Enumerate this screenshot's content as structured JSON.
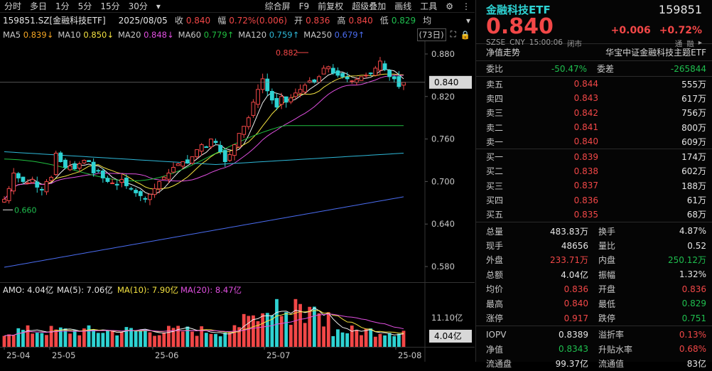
{
  "toolbar": {
    "left": [
      "分时",
      "多日",
      "1分",
      "5分",
      "15分",
      "30分",
      "▾"
    ],
    "right": [
      "综合屏",
      "F9",
      "前复权",
      "超级叠加",
      "画线",
      "工具"
    ]
  },
  "info": {
    "code": "159851.SZ[金融科技ETF]",
    "date": "2025/08/05",
    "close_label": "收",
    "close": "0.840",
    "change_label": "幅",
    "change": "0.72%(0.006)",
    "open_label": "开",
    "open": "0.836",
    "high_label": "高",
    "high": "0.840",
    "low_label": "低",
    "low": "0.829",
    "avg_label": "均"
  },
  "ma": [
    {
      "label": "MA5",
      "value": "0.839↓",
      "color": "#f0f0f0"
    },
    {
      "label": "MA10",
      "value": "0.850↓",
      "color": "#f5e341"
    },
    {
      "label": "MA20",
      "value": "0.848↓",
      "color": "#e04fe0"
    },
    {
      "label": "MA60",
      "value": "0.779↑",
      "color": "#20c040"
    },
    {
      "label": "MA120",
      "value": "0.759↑",
      "color": "#2eb8d8"
    },
    {
      "label": "MA250",
      "value": "0.679↑",
      "color": "#4a6cf0"
    }
  ],
  "ma_extra": "(73日)",
  "axis": {
    "price_ticks": [
      "0.880",
      "0.820",
      "0.760",
      "0.700",
      "0.640",
      "0.580"
    ],
    "current_tag": "0.840",
    "vol_tag": "4.04亿",
    "vol_tick": "11.10亿",
    "dates": [
      "25-04",
      "25-05",
      "25-06",
      "25-07",
      "25-08"
    ],
    "high_ann": "0.882",
    "low_ann": "0.660"
  },
  "volume": {
    "amo": "AMO: 4.04亿",
    "ma5": "MA(5): 7.06亿",
    "ma10": "MA(10): 7.90亿",
    "ma20": "MA(20): 8.47亿"
  },
  "colors": {
    "up": "#f24747",
    "down": "#1fbf4f",
    "cyan": "#2ed3d3"
  },
  "header": {
    "name": "金融科技ETF",
    "code": "159851",
    "price": "0.840",
    "change": "+0.006",
    "pct": "+0.72%",
    "sub": [
      "SZSE",
      "CNY",
      "15:00:06",
      "闭市"
    ],
    "tags": [
      "通",
      "融"
    ],
    "theme_label": "净值走势",
    "theme": "华宝中证金融科技主题ETF"
  },
  "ratio": {
    "l1": "委比",
    "v1": "-50.47%",
    "l2": "委差",
    "v2": "-265844"
  },
  "asks": [
    {
      "label": "卖五",
      "price": "0.844",
      "vol": "555万"
    },
    {
      "label": "卖四",
      "price": "0.843",
      "vol": "617万"
    },
    {
      "label": "卖三",
      "price": "0.842",
      "vol": "756万"
    },
    {
      "label": "卖二",
      "price": "0.841",
      "vol": "800万"
    },
    {
      "label": "卖一",
      "price": "0.840",
      "vol": "609万"
    }
  ],
  "bids": [
    {
      "label": "买一",
      "price": "0.839",
      "vol": "174万"
    },
    {
      "label": "买二",
      "price": "0.838",
      "vol": "602万"
    },
    {
      "label": "买三",
      "price": "0.837",
      "vol": "188万"
    },
    {
      "label": "买四",
      "price": "0.836",
      "vol": "61万"
    },
    {
      "label": "买五",
      "price": "0.835",
      "vol": "68万"
    }
  ],
  "stats": [
    [
      {
        "l": "总量",
        "v": "483.83万",
        "c": "white"
      },
      {
        "l": "换手",
        "v": "4.87%",
        "c": "white"
      }
    ],
    [
      {
        "l": "现手",
        "v": "48656",
        "c": "white"
      },
      {
        "l": "量比",
        "v": "0.52",
        "c": "white"
      }
    ],
    [
      {
        "l": "外盘",
        "v": "233.71万",
        "c": "red"
      },
      {
        "l": "内盘",
        "v": "250.12万",
        "c": "green"
      }
    ],
    [
      {
        "l": "总额",
        "v": "4.04亿",
        "c": "white"
      },
      {
        "l": "振幅",
        "v": "1.32%",
        "c": "white"
      }
    ],
    [
      {
        "l": "均价",
        "v": "0.836",
        "c": "red"
      },
      {
        "l": "开盘",
        "v": "0.836",
        "c": "red"
      }
    ],
    [
      {
        "l": "最高",
        "v": "0.840",
        "c": "red"
      },
      {
        "l": "最低",
        "v": "0.829",
        "c": "green"
      }
    ],
    [
      {
        "l": "涨停",
        "v": "0.917",
        "c": "red"
      },
      {
        "l": "跌停",
        "v": "0.751",
        "c": "green"
      }
    ]
  ],
  "iopv": [
    [
      {
        "l": "IOPV",
        "v": "0.8389",
        "c": "white"
      },
      {
        "l": "溢折率",
        "v": "0.13%",
        "c": "red"
      }
    ],
    [
      {
        "l": "净值",
        "v": "0.8343",
        "c": "green"
      },
      {
        "l": "升贴水率",
        "v": "0.68%",
        "c": "red"
      }
    ],
    [
      {
        "l": "流通盘",
        "v": "99.37亿",
        "c": "white"
      },
      {
        "l": "流通值",
        "v": "83亿",
        "c": "white"
      }
    ]
  ]
}
